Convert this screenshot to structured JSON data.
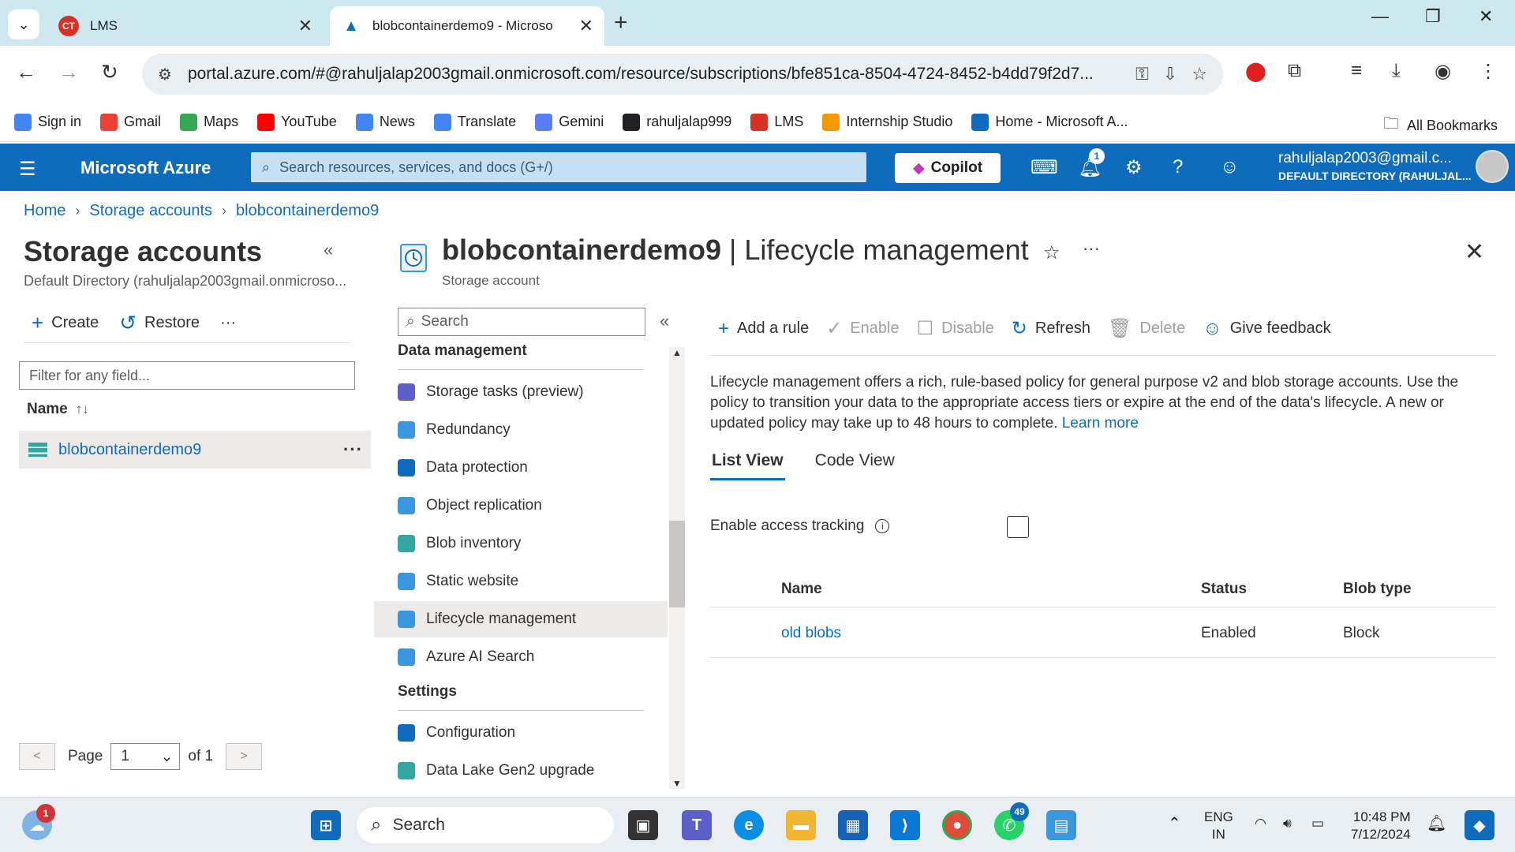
{
  "browser": {
    "tabs": [
      {
        "title": "LMS",
        "active": false
      },
      {
        "title": "blobcontainerdemo9 - Microso",
        "active": true
      }
    ],
    "url": "portal.azure.com/#@rahuljalap2003gmail.onmicrosoft.com/resource/subscriptions/bfe851ca-8504-4724-8452-b4dd79f2d7...",
    "bookmarks": [
      {
        "label": "Sign in",
        "icon": "google-icon",
        "color": "#4285f4"
      },
      {
        "label": "Gmail",
        "icon": "gmail-icon",
        "color": "#ea4335"
      },
      {
        "label": "Maps",
        "icon": "maps-icon",
        "color": "#34a853"
      },
      {
        "label": "YouTube",
        "icon": "youtube-icon",
        "color": "#ff0000"
      },
      {
        "label": "News",
        "icon": "news-icon",
        "color": "#4285f4"
      },
      {
        "label": "Translate",
        "icon": "translate-icon",
        "color": "#4285f4"
      },
      {
        "label": "Gemini",
        "icon": "gemini-icon",
        "color": "#5b7cf7"
      },
      {
        "label": "rahuljalap999",
        "icon": "github-icon",
        "color": "#202124"
      },
      {
        "label": "LMS",
        "icon": "lms-icon",
        "color": "#d93025"
      },
      {
        "label": "Internship Studio",
        "icon": "internship-icon",
        "color": "#f29900"
      },
      {
        "label": "Home - Microsoft A...",
        "icon": "azure-icon",
        "color": "#0f6cbd"
      }
    ],
    "all_bookmarks": "All Bookmarks"
  },
  "azure": {
    "brand": "Microsoft Azure",
    "search_placeholder": "Search resources, services, and docs (G+/)",
    "copilot": "Copilot",
    "notification_count": "1",
    "account_email": "rahuljalap2003@gmail.c...",
    "account_dir": "DEFAULT DIRECTORY (RAHULJAL..."
  },
  "breadcrumb": [
    "Home",
    "Storage accounts",
    "blobcontainerdemo9"
  ],
  "left_blade": {
    "title": "Storage accounts",
    "subtitle": "Default Directory (rahuljalap2003gmail.onmicroso...",
    "create": "Create",
    "restore": "Restore",
    "more": "···",
    "filter_placeholder": "Filter for any field...",
    "col_name": "Name",
    "sort": "↑↓",
    "row": "blobcontainerdemo9",
    "pager": {
      "page_label": "Page",
      "page": "1",
      "of": "of 1"
    }
  },
  "resource": {
    "title_bold": "blobcontainerdemo9",
    "title_rest": " | Lifecycle management",
    "subtitle": "Storage account",
    "menu_search": "Search",
    "sections": [
      {
        "label": "Data management",
        "items": [
          {
            "label": "Storage tasks (preview)",
            "color": "#5b5fc7",
            "selected": false
          },
          {
            "label": "Redundancy",
            "color": "#3a96dd",
            "selected": false
          },
          {
            "label": "Data protection",
            "color": "#0f6cbd",
            "selected": false
          },
          {
            "label": "Object replication",
            "color": "#3a96dd",
            "selected": false
          },
          {
            "label": "Blob inventory",
            "color": "#35a5a0",
            "selected": false
          },
          {
            "label": "Static website",
            "color": "#3a96dd",
            "selected": false
          },
          {
            "label": "Lifecycle management",
            "color": "#3a96dd",
            "selected": true
          },
          {
            "label": "Azure AI Search",
            "color": "#3a96dd",
            "selected": false
          }
        ]
      },
      {
        "label": "Settings",
        "items": [
          {
            "label": "Configuration",
            "color": "#0f6cbd",
            "selected": false
          },
          {
            "label": "Data Lake Gen2 upgrade",
            "color": "#35a5a0",
            "selected": false
          }
        ]
      }
    ],
    "commands": {
      "add": "Add a rule",
      "enable": "Enable",
      "disable": "Disable",
      "refresh": "Refresh",
      "delete": "Delete",
      "feedback": "Give feedback"
    },
    "description": "Lifecycle management offers a rich, rule-based policy for general purpose v2 and blob storage accounts. Use the policy to transition your data to the appropriate access tiers or expire at the end of the data's lifecycle. A new or updated policy may take up to 48 hours to complete.",
    "learn_more": "Learn more",
    "tabs": [
      "List View",
      "Code View"
    ],
    "access_tracking": "Enable access tracking",
    "table": {
      "headers": {
        "name": "Name",
        "status": "Status",
        "blob_type": "Blob type"
      },
      "rows": [
        {
          "name": "old blobs",
          "status": "Enabled",
          "blob_type": "Block"
        }
      ]
    }
  },
  "taskbar": {
    "search": "Search",
    "weather_badge": "1",
    "whatsapp_badge": "49",
    "lang": "ENG",
    "region": "IN",
    "time": "10:48 PM",
    "date": "7/12/2024"
  }
}
